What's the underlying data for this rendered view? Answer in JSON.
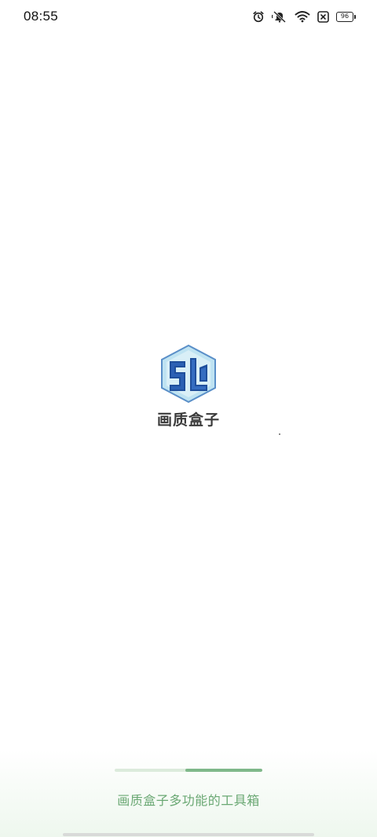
{
  "status_bar": {
    "time": "08:55",
    "icons": [
      "alarm-icon",
      "mute-icon",
      "wifi-icon",
      "sim-off-icon",
      "battery-icon"
    ],
    "battery_level": "96"
  },
  "splash": {
    "logo": "sl-hexagon-logo",
    "app_name": "画质盒子",
    "tagline": "画质盒子多功能的工具箱",
    "loading_progress_start": 0.48,
    "loading_progress_end": 1.0
  },
  "colors": {
    "accent_green": "#7fb88a",
    "tagline_green": "#6aa873",
    "logo_blue": "#1f4f9c",
    "logo_light_blue": "#bfe3f2"
  }
}
